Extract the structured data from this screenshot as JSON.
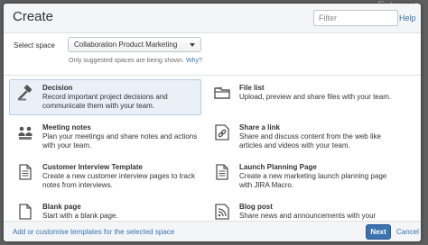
{
  "backdrop": {
    "text": "Extranet"
  },
  "dialog": {
    "title": "Create",
    "filter_placeholder": "Filter",
    "help_label": "Help"
  },
  "space": {
    "label": "Select space",
    "selected": "Collaboration Product Marketing",
    "note": "Only suggested spaces are being shown.",
    "why_label": "Why?"
  },
  "templates": [
    {
      "name": "Decision",
      "desc": "Record important project decisions and communicate them with your team.",
      "icon": "decision-icon",
      "selected": true
    },
    {
      "name": "File list",
      "desc": "Upload, preview and share files with your team.",
      "icon": "folder-icon",
      "selected": false
    },
    {
      "name": "Meeting notes",
      "desc": "Plan your meetings and share notes and actions with your team.",
      "icon": "meeting-notes-icon",
      "selected": false
    },
    {
      "name": "Share a link",
      "desc": "Share and discuss content from the web like articles and videos with your team.",
      "icon": "link-icon",
      "selected": false
    },
    {
      "name": "Customer Interview Template",
      "desc": "Create a new customer interview pages to track notes from interviews.",
      "icon": "page-icon",
      "selected": false
    },
    {
      "name": "Launch Planning Page",
      "desc": "Create a new marketing launch planning page with JIRA Macro.",
      "icon": "page-icon",
      "selected": false
    },
    {
      "name": "Blank page",
      "desc": "Start with a blank page.",
      "icon": "blank-page-icon",
      "selected": false
    },
    {
      "name": "Blog post",
      "desc": "Share news and announcements with your team.",
      "icon": "blog-icon",
      "selected": false
    }
  ],
  "footer": {
    "customise_link": "Add or customise templates for the selected space",
    "next_label": "Next",
    "cancel_label": "Cancel"
  },
  "colors": {
    "accent": "#3b73af",
    "link": "#3572b0",
    "selected_bg": "#e9f0f8"
  }
}
